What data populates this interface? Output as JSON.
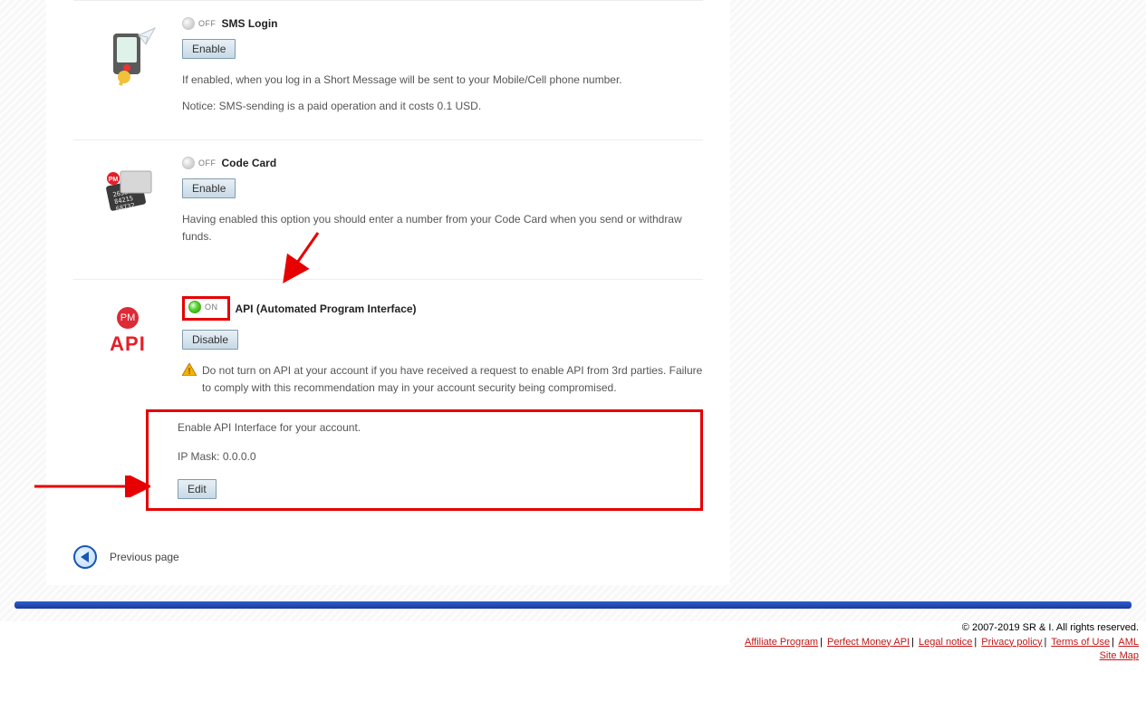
{
  "sections": {
    "sms": {
      "status": "OFF",
      "title": "SMS Login",
      "button": "Enable",
      "desc": "If enabled, when you log in a Short Message will be sent to your Mobile/Cell phone number.",
      "notice": "Notice: SMS-sending is a paid operation and it costs 0.1 USD."
    },
    "codecard": {
      "status": "OFF",
      "title": "Code Card",
      "button": "Enable",
      "desc": "Having enabled this option you should enter a number from your Code Card when you send or withdraw funds."
    },
    "api": {
      "status": "ON",
      "title": "API (Automated Program Interface)",
      "button": "Disable",
      "warning": "Do not turn on API at your account if you have received a request to enable API from 3rd parties. Failure to comply with this recommendation may in your account security being compromised.",
      "enable_desc": "Enable API Interface for your account.",
      "ip_mask_label": "IP Mask:",
      "ip_mask_value": "0.0.0.0",
      "edit_button": "Edit"
    }
  },
  "api_icon": {
    "pm": "PM",
    "api": "API"
  },
  "previous": "Previous page",
  "footer": {
    "copyright": "© 2007-2019 SR & I. All rights reserved.",
    "links": {
      "affiliate": "Affiliate Program",
      "api": "Perfect Money API",
      "legal": "Legal notice",
      "privacy": "Privacy policy",
      "terms": "Terms of Use",
      "aml": "AML",
      "sitemap": "Site Map"
    }
  }
}
